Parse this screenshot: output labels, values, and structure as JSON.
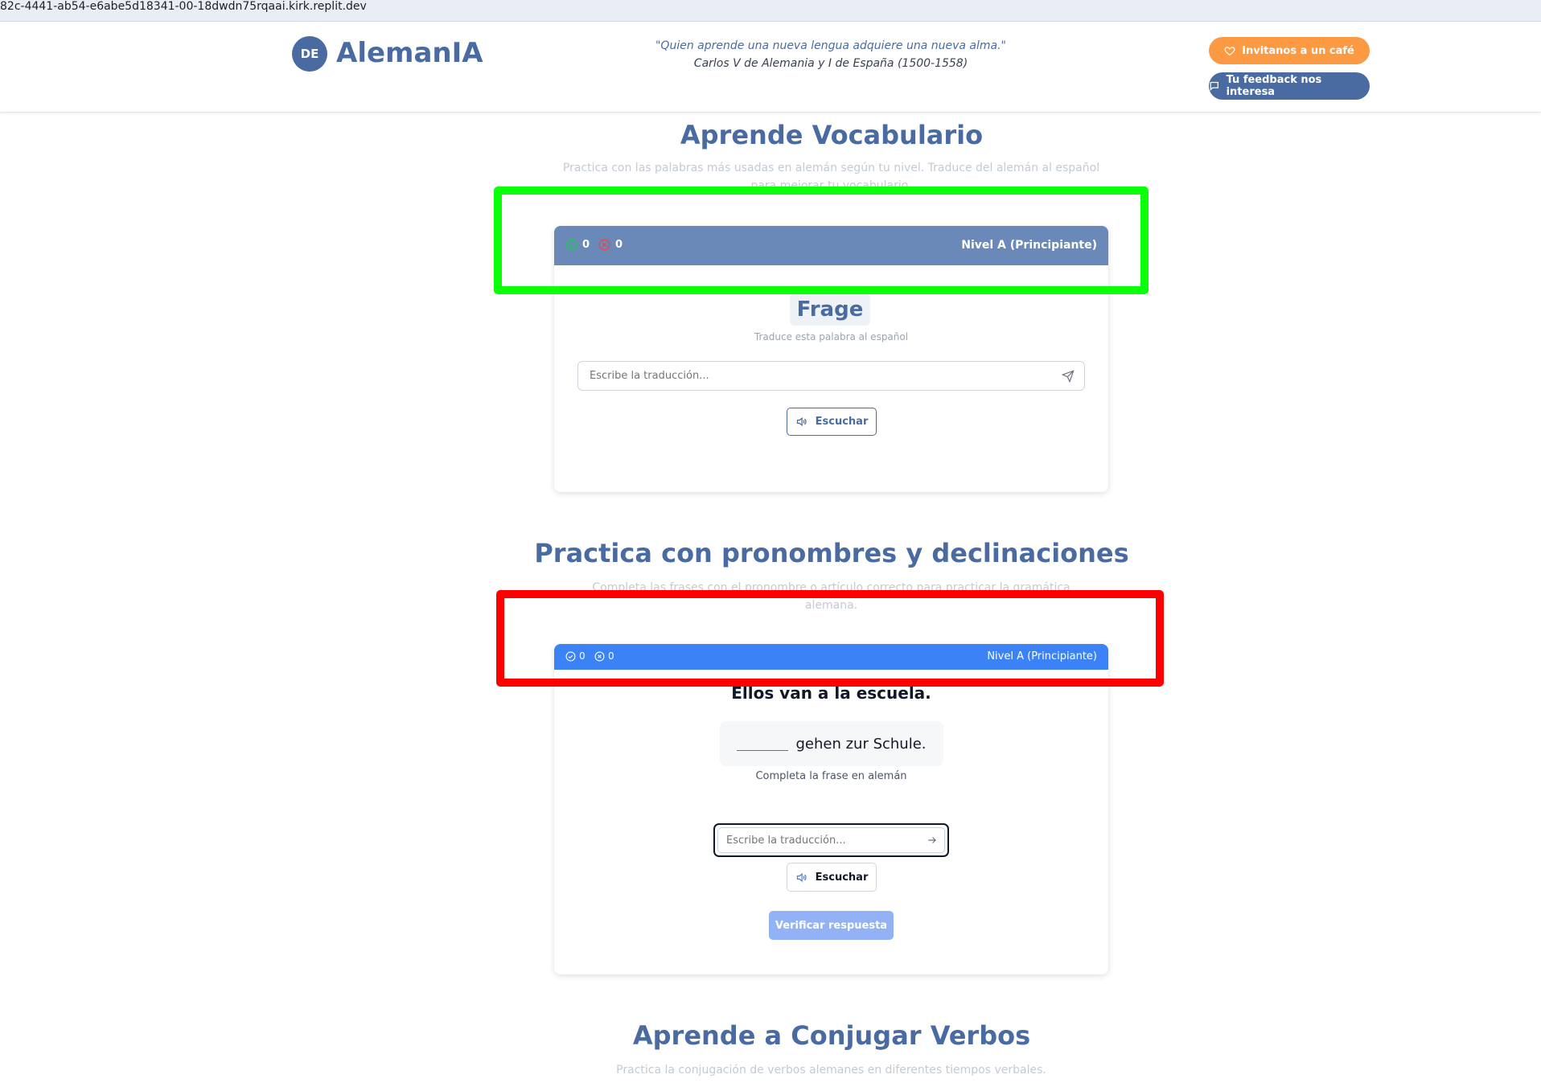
{
  "browser": {
    "url": "82c-4441-ab54-e6abe5d18341-00-18dwdn75rqaai.kirk.replit.dev"
  },
  "header": {
    "logo_badge": "DE",
    "logo_text": "AlemanIA",
    "quote": "\"Quien aprende una nueva lengua adquiere una nueva alma.\"",
    "quote_author": "Carlos V de Alemania y I de España (1500-1558)",
    "cafe_button": "Invitanos a un café",
    "feedback_button": "Tu feedback nos interesa"
  },
  "vocab": {
    "title": "Aprende Vocabulario",
    "subtitle_line1": "Practica con las palabras más usadas en alemán según tu nivel. Traduce del alemán al español",
    "subtitle_line2": "para mejorar tu vocabulario.",
    "correct_count": "0",
    "wrong_count": "0",
    "level": "Nivel A (Principiante)",
    "word": "Frage",
    "hint": "Traduce esta palabra al español",
    "input_placeholder": "Escribe la traducción...",
    "listen_button": "Escuchar"
  },
  "pronouns": {
    "title": "Practica con pronombres y declinaciones",
    "subtitle_line1": "Completa las frases con el pronombre o artículo correcto para practicar la gramática",
    "subtitle_line2": "alemana.",
    "correct_count": "0",
    "wrong_count": "0",
    "level": "Nivel A (Principiante)",
    "sentence_es": "Ellos van a la escuela.",
    "sentence_de_rest": "gehen zur Schule.",
    "complete_label": "Completa la frase en alemán",
    "input_placeholder": "Escribe la traducción...",
    "listen_button": "Escuchar",
    "verify_button": "Verificar respuesta"
  },
  "verbs": {
    "title": "Aprende a Conjugar Verbos",
    "subtitle": "Practica la conjugación de verbos alemanes en diferentes tiempos verbales."
  },
  "colors": {
    "brand": "#4a6ba1",
    "cafe": "#fb9a42",
    "pronoun_header": "#3b82f6",
    "vocab_header": "#6b89b8",
    "highlight_green": "#0bff08",
    "highlight_red": "#ff0000"
  }
}
